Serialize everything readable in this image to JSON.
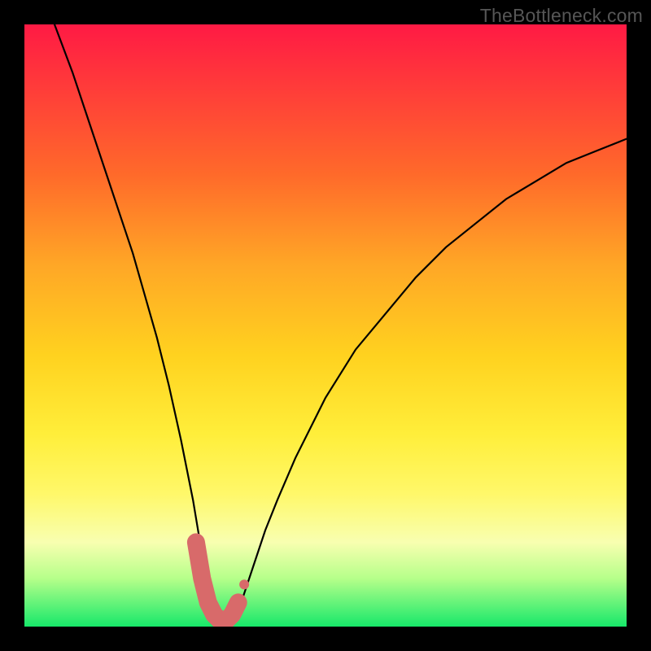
{
  "brand": "TheBottleneck.com",
  "chart_data": {
    "type": "line",
    "title": "",
    "xlabel": "",
    "ylabel": "",
    "xlim": [
      0,
      100
    ],
    "ylim": [
      0,
      100
    ],
    "series": [
      {
        "name": "bottleneck-curve",
        "x": [
          5,
          8,
          10,
          12,
          14,
          16,
          18,
          20,
          22,
          24,
          26,
          27,
          28,
          29,
          30,
          31,
          32,
          33,
          34,
          35,
          36,
          37,
          38,
          40,
          42,
          45,
          50,
          55,
          60,
          65,
          70,
          75,
          80,
          85,
          90,
          95,
          100
        ],
        "y": [
          100,
          92,
          86,
          80,
          74,
          68,
          62,
          55,
          48,
          40,
          31,
          26,
          21,
          15,
          9,
          5,
          2,
          1,
          1,
          2,
          4,
          7,
          10,
          16,
          21,
          28,
          38,
          46,
          52,
          58,
          63,
          67,
          71,
          74,
          77,
          79,
          81
        ]
      }
    ],
    "markers": {
      "name": "highlight-band",
      "x": [
        28.5,
        29.5,
        30.5,
        31.5,
        32.5,
        33.5,
        34.5,
        35.5,
        36.5
      ],
      "y": [
        14,
        8,
        4,
        2,
        1,
        1,
        2,
        4,
        7
      ],
      "color": "#d86a6a",
      "size_large_indices": [
        0,
        1,
        2,
        3,
        4,
        5,
        6,
        7
      ],
      "size_small_indices": [
        8
      ]
    },
    "colors": {
      "curve": "#000000",
      "marker": "#d86a6a",
      "background_gradient_top": "#ff1a44",
      "background_gradient_bottom": "#17e86a"
    }
  }
}
